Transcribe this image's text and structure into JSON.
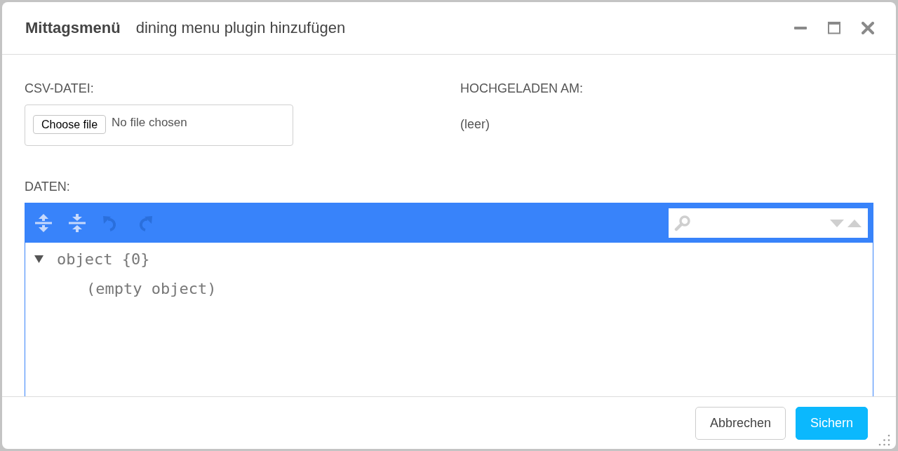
{
  "window": {
    "title": "Mittagsmenü",
    "subtitle": "dining menu plugin hinzufügen"
  },
  "csv_file": {
    "label": "CSV-DATEI:",
    "button": "Choose file",
    "status": "No file chosen"
  },
  "uploaded_at": {
    "label": "HOCHGELADEN AM:",
    "value": "(leer)"
  },
  "data": {
    "label": "DATEN:",
    "toolbar": [
      {
        "kind": "expand_all",
        "disabled": false
      },
      {
        "kind": "collapse_all",
        "disabled": false
      },
      {
        "kind": "undo",
        "disabled": true
      },
      {
        "kind": "redo",
        "disabled": true
      }
    ],
    "tree": {
      "label": "object {0}",
      "expanded": true,
      "empty_text": "(empty object)"
    }
  },
  "buttons": [
    {
      "label": "Abbrechen",
      "kind": "secondary"
    },
    {
      "label": "Sichern",
      "kind": "primary"
    }
  ]
}
